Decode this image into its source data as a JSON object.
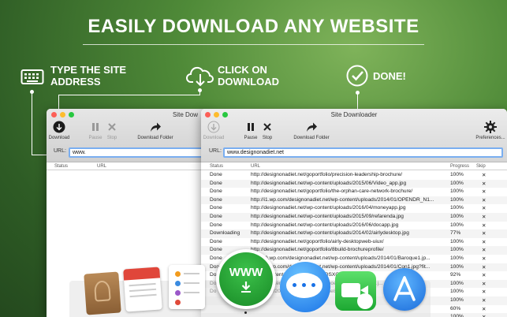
{
  "headline": "EASILY DOWNLOAD ANY WEBSITE",
  "steps": [
    {
      "line1": "TYPE THE SITE",
      "line2": "ADDRESS",
      "icon": "keyboard-icon"
    },
    {
      "line1": "CLICK ON",
      "line2": "DOWNLOAD",
      "icon": "cloud-download-icon"
    },
    {
      "line1": "DONE!",
      "line2": "",
      "icon": "checkmark-circle-icon"
    }
  ],
  "back_window": {
    "title": "Site Dow",
    "toolbar": {
      "download": "Download",
      "pause": "Pause",
      "stop": "Stop",
      "download_folder": "Download Folder"
    },
    "url_label": "URL:",
    "url_value": "www.",
    "columns": {
      "status": "Status",
      "url": "URL"
    }
  },
  "front_window": {
    "title": "Site Downloader",
    "toolbar": {
      "download": "Download",
      "pause": "Pause",
      "stop": "Stop",
      "download_folder": "Download Folder",
      "preferences": "Preferences..."
    },
    "url_label": "URL:",
    "url_value": "www.designonadiet.net",
    "columns": {
      "status": "Status",
      "url": "URL",
      "progress": "Progress",
      "skip": "Skip"
    },
    "rows": [
      {
        "status": "Done",
        "url": "http://designonadiet.net/goportfolio/precision-leadership-brochure/",
        "progress": "100%"
      },
      {
        "status": "Done",
        "url": "http://designonadiet.net/wp-content/uploads/2015/06/Video_app.jpg",
        "progress": "100%"
      },
      {
        "status": "Done",
        "url": "http://designonadiet.net/goportfolio/the-orphan-care-network-brochure/",
        "progress": "100%"
      },
      {
        "status": "Done",
        "url": "http://i1.wp.com/designonadiet.net/wp-content/uploads/2014/01/OPENDR_N1...",
        "progress": "100%"
      },
      {
        "status": "Done",
        "url": "http://designonadiet.net/wp-content/uploads/2016/04/moneyapp.jpg",
        "progress": "100%"
      },
      {
        "status": "Done",
        "url": "http://designonadiet.net/wp-content/uploads/2015/09/refarenda.jpg",
        "progress": "100%"
      },
      {
        "status": "Done",
        "url": "http://designonadiet.net/wp-content/uploads/2016/06/docapp.jpg",
        "progress": "100%"
      },
      {
        "status": "Downloading",
        "url": "http://designonadiet.net/wp-content/uploads/2014/02/airlydesktop.jpg",
        "progress": "77%"
      },
      {
        "status": "Done",
        "url": "http://designonadiet.net/goportfolio/airly-desktopweb-uiux/",
        "progress": "100%"
      },
      {
        "status": "Done",
        "url": "http://designonadiet.net/goportfolio/8build-brochureprofile/",
        "progress": "100%"
      },
      {
        "status": "Done",
        "url": "http://i0.wp.com/designonadiet.net/wp-content/uploads/2014/01/Baroque1.jp...",
        "progress": "100%"
      },
      {
        "status": "Done",
        "url": "http://i0.wp.com/designonadiet.net/wp-content/uploads/2014/01/Con1.jpg?fit...",
        "progress": "100%"
      },
      {
        "status": "Do",
        "url": "...t/wp-content/uploads/2015/11/OSXCleaner.jpg",
        "progress": "92%"
      },
      {
        "status": "Do",
        "url": "...t/wp-content/uploads/2014/11/Phoenix_website-copy.j...",
        "progress": "100%"
      },
      {
        "status": "Do",
        "url": "...uploads/2014/10/Charlotte_phone8sm...",
        "progress": "100%"
      },
      {
        "status": "",
        "url": "",
        "progress": "100%"
      },
      {
        "status": "",
        "url": "",
        "progress": "60%"
      },
      {
        "status": "",
        "url": "",
        "progress": "100%"
      }
    ]
  },
  "dock": {
    "apps": [
      "contacts-icon",
      "calendar-icon",
      "reminders-icon",
      "site-downloader-icon",
      "messages-icon",
      "facetime-icon",
      "app-store-icon"
    ],
    "www_label": "WWW"
  },
  "colors": {
    "accent_green": "#1f9a2f",
    "selection_blue": "#7aaef0",
    "close_red": "#fc5f57",
    "minimize_yellow": "#fdbc2e",
    "zoom_green": "#28c840"
  }
}
